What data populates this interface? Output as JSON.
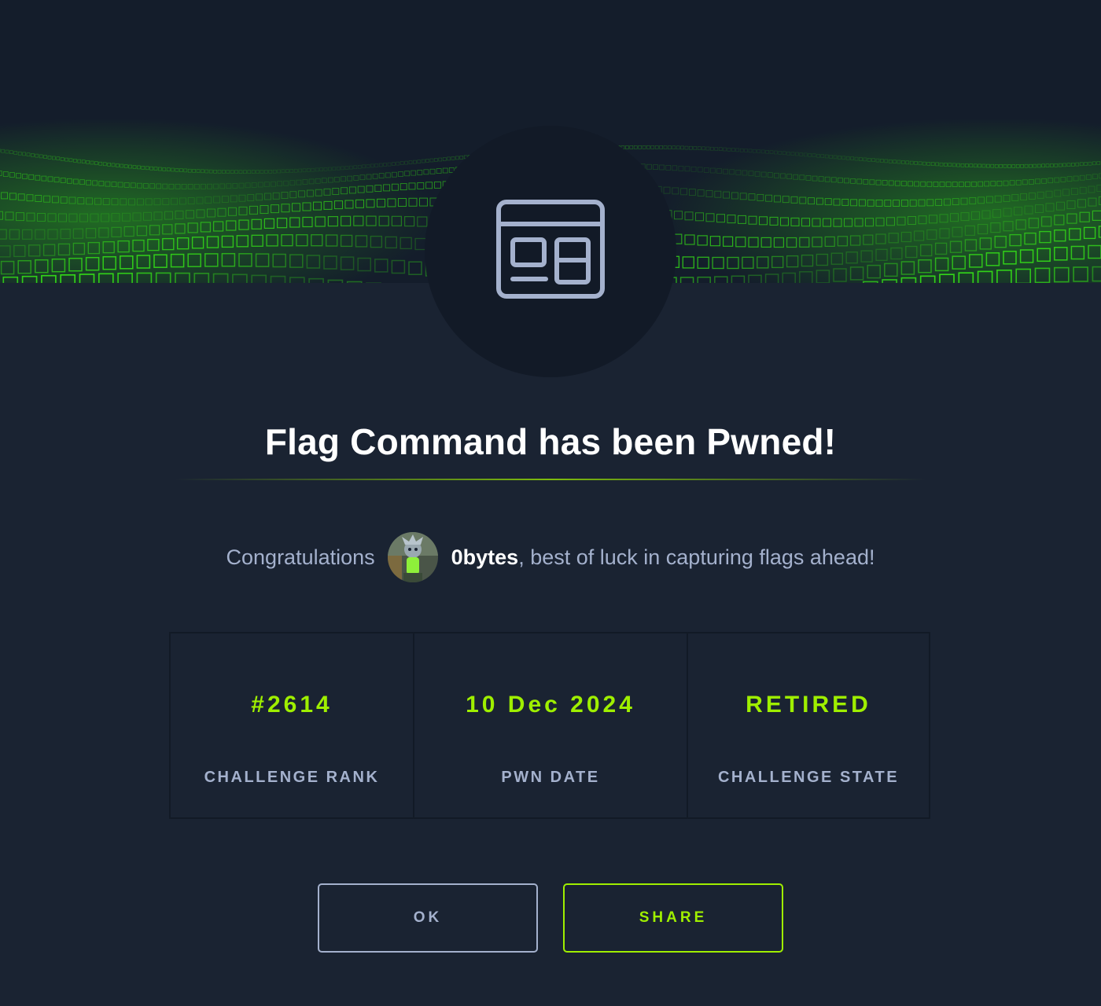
{
  "modal": {
    "title": "Flag Command has been Pwned!",
    "badge_icon": "browser-window-icon",
    "banner_image": "green-cube-wave-banner"
  },
  "congrats": {
    "prefix": "Congratulations",
    "avatar_icon": "user-avatar",
    "username": "0bytes",
    "suffix": ", best of luck in capturing flags ahead!"
  },
  "stats": [
    {
      "value": "#2614",
      "label": "CHALLENGE RANK"
    },
    {
      "value": "10 Dec 2024",
      "label": "PWN DATE"
    },
    {
      "value": "RETIRED",
      "label": "CHALLENGE STATE"
    }
  ],
  "buttons": {
    "ok_label": "OK",
    "share_label": "SHARE"
  },
  "colors": {
    "background": "#1a2332",
    "background_dark": "#141d2b",
    "accent": "#9fef00",
    "muted_text": "#a4b1cd",
    "white": "#ffffff"
  }
}
